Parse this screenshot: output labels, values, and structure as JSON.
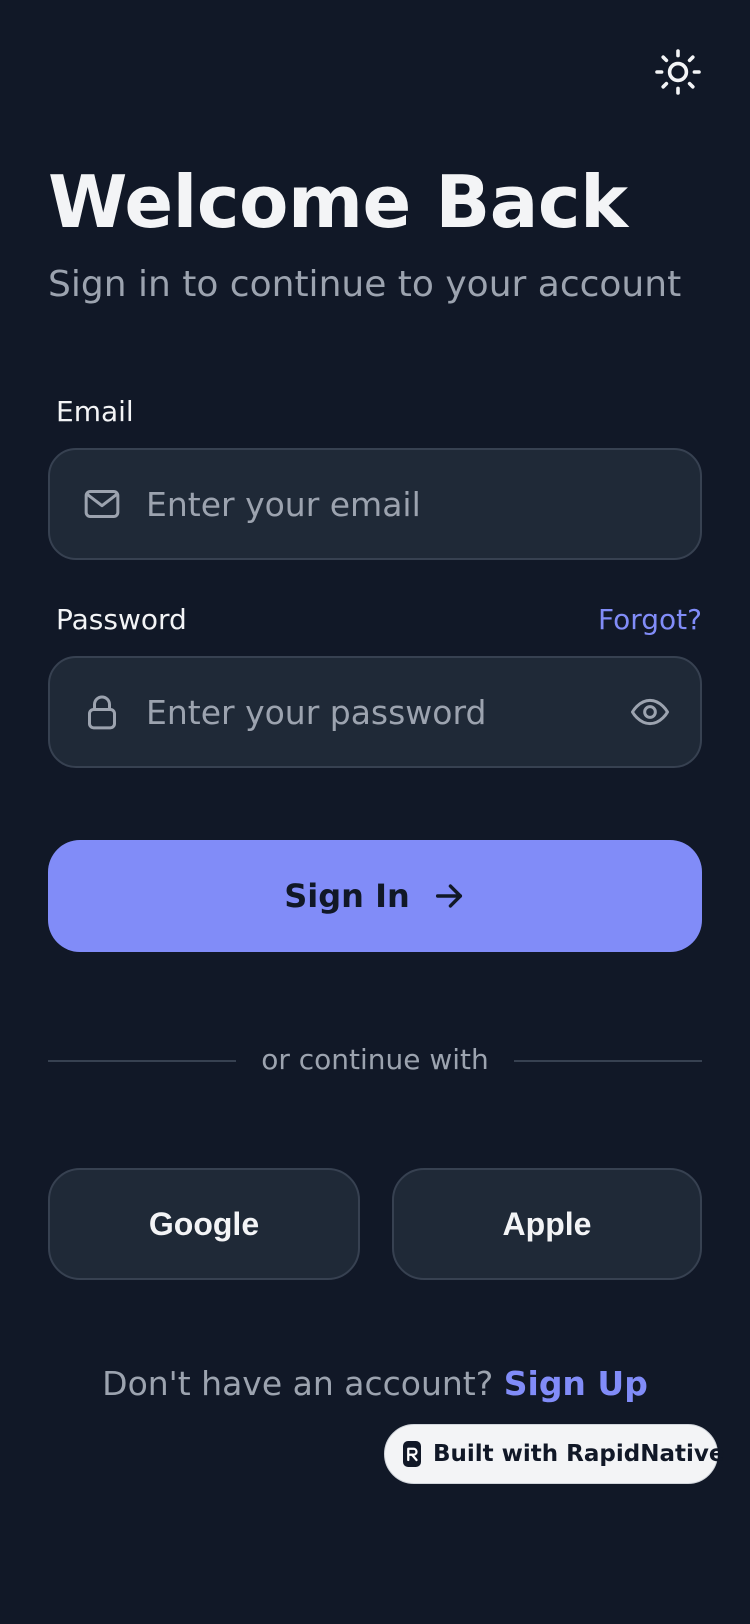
{
  "header": {
    "theme_icon": "sun-icon",
    "title": "Welcome Back",
    "subtitle": "Sign in to continue to your account"
  },
  "form": {
    "email": {
      "label": "Email",
      "placeholder": "Enter your email",
      "value": "",
      "icon": "mail-icon"
    },
    "password": {
      "label": "Password",
      "placeholder": "Enter your password",
      "value": "",
      "icon": "lock-icon",
      "toggle_icon": "eye-icon"
    },
    "forgot_label": "Forgot?",
    "submit_label": "Sign In",
    "submit_icon": "arrow-right-icon"
  },
  "divider": {
    "text": "or continue with"
  },
  "social": {
    "google_label": "Google",
    "apple_label": "Apple"
  },
  "footer": {
    "prompt": "Don't have an account?",
    "signup_label": "Sign Up"
  },
  "badge": {
    "label": "Built with RapidNative"
  },
  "colors": {
    "background": "#111827",
    "surface": "#1f2937",
    "border": "#374151",
    "accent": "#818cf8",
    "text": "#f3f4f6",
    "muted": "#9ca3af"
  }
}
